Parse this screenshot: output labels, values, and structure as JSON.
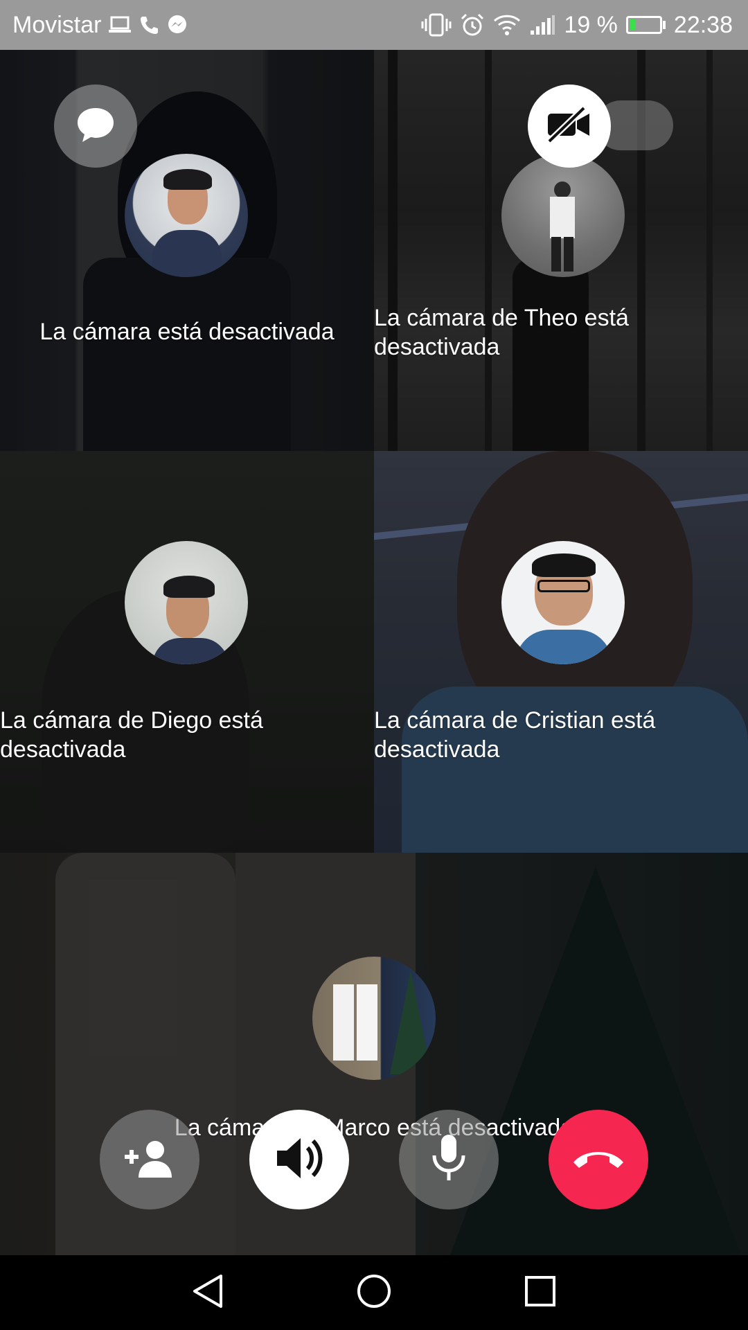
{
  "status_bar": {
    "carrier": "Movistar",
    "battery_percent": "19 %",
    "battery_level": 0.19,
    "time": "22:38",
    "left_icons": [
      "laptop-icon",
      "phone-icon",
      "messenger-icon"
    ],
    "right_icons": [
      "vibrate-icon",
      "alarm-icon",
      "wifi-icon",
      "signal-icon",
      "battery-charging-icon"
    ]
  },
  "participants": [
    {
      "id": "self",
      "camera_off_text": "La cámara está desactivada"
    },
    {
      "id": "theo",
      "camera_off_text": "La cámara de Theo está desactivada"
    },
    {
      "id": "diego",
      "camera_off_text": "La cámara de Diego está desactivada"
    },
    {
      "id": "cristian",
      "camera_off_text": "La cámara de Cristian está desactivada"
    },
    {
      "id": "marco",
      "camera_off_text": "La cámara de Marco está desactivada"
    }
  ],
  "top_controls": {
    "chat_icon": "chat-bubble-icon",
    "camera_toggle_icon": "video-off-icon"
  },
  "bottom_controls": {
    "add_person_icon": "add-person-icon",
    "speaker_icon": "speaker-icon",
    "mic_icon": "microphone-icon",
    "end_call_icon": "end-call-icon",
    "end_call_color": "#f5264f"
  },
  "nav_bar": {
    "icons": [
      "back-icon",
      "home-icon",
      "recents-icon"
    ]
  }
}
